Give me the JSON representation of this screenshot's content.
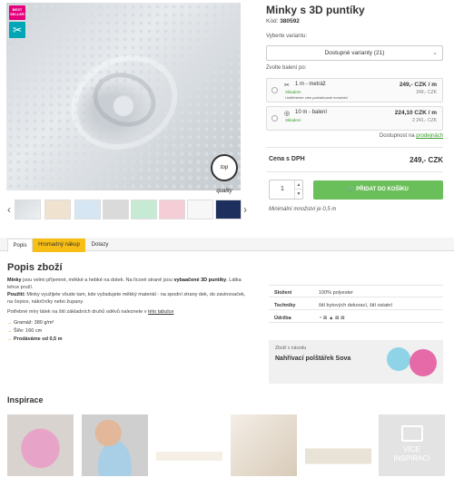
{
  "product": {
    "title": "Minky s 3D puntíky",
    "code_label": "Kód:",
    "code": "380592",
    "badges": {
      "best": "BEST SELLER",
      "cut_icon": "scissors-icon"
    },
    "seal_text": "top quality"
  },
  "variant": {
    "label": "Vyberte variantu:",
    "selected": "Dostupné varianty (21)"
  },
  "packaging": {
    "label": "Zvolte balení po:",
    "options": [
      {
        "icon": "scissors-icon",
        "name": "1 m - metráž",
        "stock": "Skladem",
        "note": "Ustřihneme vám požadované množství",
        "price": "249,- CZK / m",
        "sub": "249,- CZK"
      },
      {
        "icon": "roll-icon",
        "name": "10 m - balení",
        "stock": "Skladem",
        "note": "",
        "price": "224,10 CZK / m",
        "sub": "2 241,- CZK"
      }
    ]
  },
  "availability": {
    "label": "Dostupnost na",
    "link": "prodejnách"
  },
  "price": {
    "label": "Cena s DPH",
    "value": "249,- CZK"
  },
  "cart": {
    "qty": "1",
    "button": "PŘIDAT DO KOŠÍKU",
    "min_note": "Minimální množství je 0,5 m"
  },
  "tabs": [
    "Popis",
    "Hromadný nákup",
    "Dotazy"
  ],
  "description": {
    "title": "Popis zboží",
    "p1_b": "Minky",
    "p1": " jsou velmi příjemné, měkké a hebké na dotek. Na lícové straně jsou ",
    "p1_b2": "vybaačené 3D puntíky",
    "p1_end": ". Látka lehce pruží.",
    "p2_b": "Použití:",
    "p2": " Minky využijete všude tam, kde vyžadujete měkký materiál - na spodní strany dek, do zavinovaček, na čepice, nákrčníky nebo župany.",
    "p3": "Potřebné míry látek na šití základních druhů oděvů naleznete v ",
    "p3_link": "této tabulce",
    "specs": [
      "Gramáž: 380 g/m²",
      "Šíře: 160 cm",
      "Prodáváme od 0,5 m"
    ]
  },
  "spec_table": [
    {
      "k": "Složení",
      "v": "100% polyester"
    },
    {
      "k": "Techniky",
      "v": "šití bytových dekorací, šití ostatní"
    },
    {
      "k": "Údržba",
      "v": "◔ ⊠ ▲ ⊠ ⊠"
    }
  ],
  "guide_card": {
    "small": "Zboží v návodu",
    "big": "Nahřívací polštářek Sova"
  },
  "inspirace": {
    "title": "Inspirace",
    "more": "VÍCE INSPIRACÍ"
  },
  "colors": {
    "green": "#6bbf5a",
    "orange": "#f7be16",
    "link_green": "#3a9b2c",
    "pink": "#e4007d",
    "teal": "#00a6b6"
  }
}
